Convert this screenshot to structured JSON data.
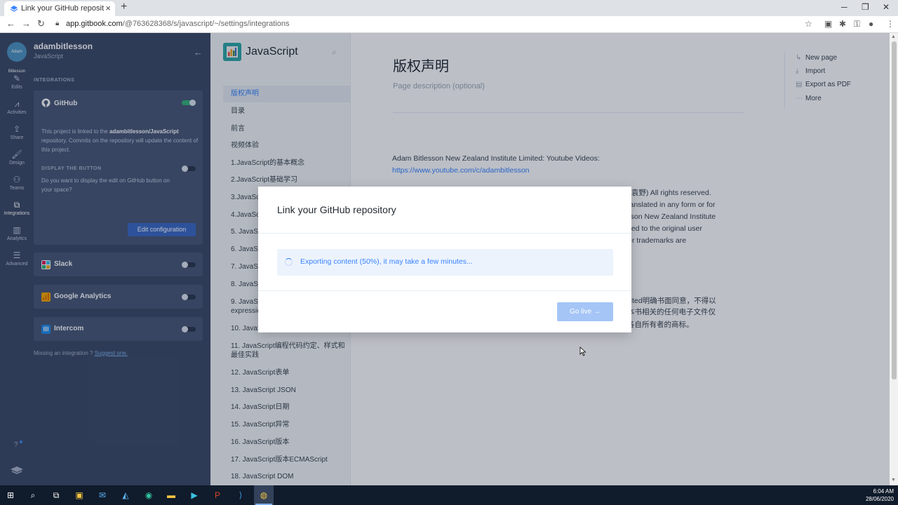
{
  "browser": {
    "tab_title": "Link your GitHub repository - JavaS",
    "url_host": "app.gitbook.com",
    "url_path": "/@763628368/s/javascript/~/settings/integrations"
  },
  "rail": {
    "avatar_text": "Adam Bitlesson",
    "items": [
      {
        "label": "Edits",
        "icon": "pencil-icon"
      },
      {
        "label": "Activities",
        "icon": "activity-icon"
      },
      {
        "label": "Share",
        "icon": "share-icon"
      },
      {
        "label": "Design",
        "icon": "brush-icon"
      },
      {
        "label": "Teams",
        "icon": "teams-icon"
      },
      {
        "label": "Integrations",
        "icon": "puzzle-icon"
      },
      {
        "label": "Analytics",
        "icon": "bar-chart-icon"
      },
      {
        "label": "Advanced",
        "icon": "sliders-icon"
      }
    ],
    "help": "?"
  },
  "panel": {
    "user_name": "adambitlesson",
    "space_name": "JavaScript",
    "section_title": "INTEGRATIONS",
    "github": {
      "name": "GitHub",
      "enabled": true,
      "desc_pre": "This project is linked to the ",
      "desc_repo": "adambitlesson/JavaScript",
      "desc_post": " repository. Commits on the repository will update the content of this project.",
      "display_label": "DISPLAY THE BUTTON",
      "display_question": "Do you want to display the edit on GitHub button on your space?",
      "edit_button": "Edit configuration"
    },
    "slack": {
      "name": "Slack",
      "enabled": false
    },
    "google_analytics": {
      "name": "Google Analytics",
      "enabled": false
    },
    "intercom": {
      "name": "Intercom",
      "enabled": false
    },
    "missing_text": "Missing an integration ? ",
    "suggest_link": "Suggest one."
  },
  "toc": {
    "space_title": "JavaScript",
    "items": [
      "版权声明",
      "目录",
      "前言",
      "视频体验",
      "1.JavaScript的基本概念",
      "2.JavaScript基础学习",
      "3.JavaSc",
      "4.JavaSc",
      "5. JavaSc",
      "6. JavaSc",
      "7. JavaSc",
      "8. JavaSc",
      "9. JavaSc",
      "expressio",
      "10. JavaS",
      "11. JavaScript编程代码约定、样式和最佳实践",
      "12. JavaScript表单",
      "13. JavaScript JSON",
      "14. JavaScript日期",
      "15. JavaScript异常",
      "16. JavaScript版本",
      "17. JavaScript版本ECMAScript",
      "18. JavaScript DOM"
    ]
  },
  "doc": {
    "title": "版权声明",
    "description_placeholder": "Page description (optional)",
    "para1_text": "Adam Bitlesson New Zealand Institute Limited: Youtube Videos:",
    "para1_link": "https://www.youtube.com/c/adambitlesson",
    "clipped_lines": [
      "n Ye (袁野) All rights reserved.",
      ", or translated in any form or for",
      "Bitlesson New Zealand Institute",
      "licensed to the original user",
      "ll other trademarks are",
      "e Limited明确书面同意，不得以",
      "件与本书相关的任何电子文件仅",
      "为其各自所有者的商标。"
    ],
    "right_menu": [
      {
        "label": "New page",
        "icon": "new-page-icon"
      },
      {
        "label": "Import",
        "icon": "import-icon"
      },
      {
        "label": "Export as PDF",
        "icon": "pdf-icon"
      },
      {
        "label": "More",
        "icon": "more-icon"
      }
    ]
  },
  "modal": {
    "title": "Link your GitHub repository",
    "progress_percent": 50,
    "progress_text": "Exporting content (50%), it may take a few minutes...",
    "go_live_label": "Go live →"
  },
  "taskbar": {
    "time": "6:04 AM",
    "date": "28/06/2020"
  }
}
